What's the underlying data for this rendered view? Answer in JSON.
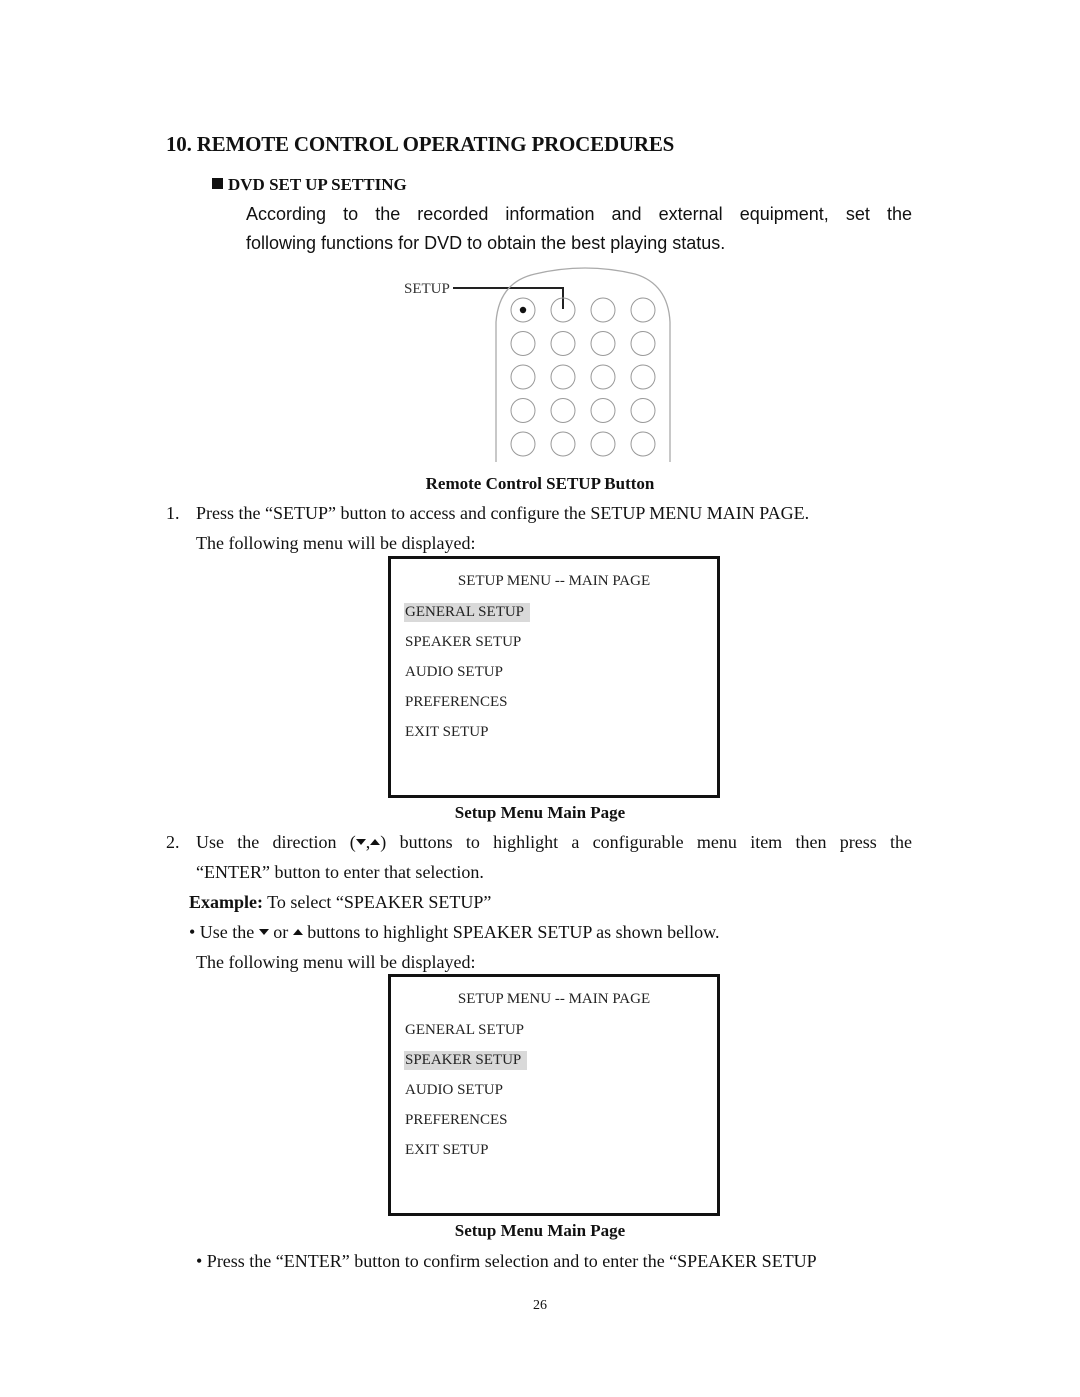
{
  "section": {
    "number": "10.",
    "title": "REMOTE CONTROL OPERATING PROCEDURES"
  },
  "subsection": {
    "bullet_icon": "black-square",
    "title": "DVD SET UP SETTING"
  },
  "intro": {
    "line1": "According to the recorded information and external equipment, set the",
    "line2": "following functions for DVD to obtain the best playing status."
  },
  "remote_figure": {
    "callout_label": "SETUP",
    "button_rows": 5,
    "button_cols": 4,
    "caption": "Remote Control SETUP Button"
  },
  "step1": {
    "number": "1.",
    "line1": "Press the “SETUP” button to access and configure the SETUP MENU MAIN PAGE.",
    "line2": "The following menu will be displayed:"
  },
  "menu1": {
    "title": "SETUP MENU -- MAIN PAGE",
    "items": [
      "GENERAL SETUP",
      "SPEAKER SETUP",
      "AUDIO SETUP",
      "PREFERENCES",
      "EXIT SETUP"
    ],
    "highlighted": "GENERAL SETUP",
    "caption": "Setup Menu Main Page"
  },
  "step2": {
    "number": "2.",
    "line1_a": "Use the direction (",
    "line1_sep": ",",
    "line1_b": ") buttons to highlight a configurable menu item then press the",
    "line2": "“ENTER” button to enter that selection.",
    "example_label": "Example:",
    "example_text": " To select “SPEAKER SETUP”",
    "bullet_a": "• Use the ",
    "bullet_or": " or ",
    "bullet_b": " buttons to highlight SPEAKER SETUP as shown bellow.",
    "line_display": "The following menu will be displayed:"
  },
  "menu2": {
    "title": "SETUP MENU -- MAIN PAGE",
    "items": [
      "GENERAL SETUP",
      "SPEAKER SETUP",
      "AUDIO SETUP",
      "PREFERENCES",
      "EXIT SETUP"
    ],
    "highlighted": "SPEAKER SETUP",
    "caption": "Setup Menu Main Page"
  },
  "final_bullet": "• Press the “ENTER” button to confirm selection and to enter the “SPEAKER SETUP",
  "page_number": "26"
}
